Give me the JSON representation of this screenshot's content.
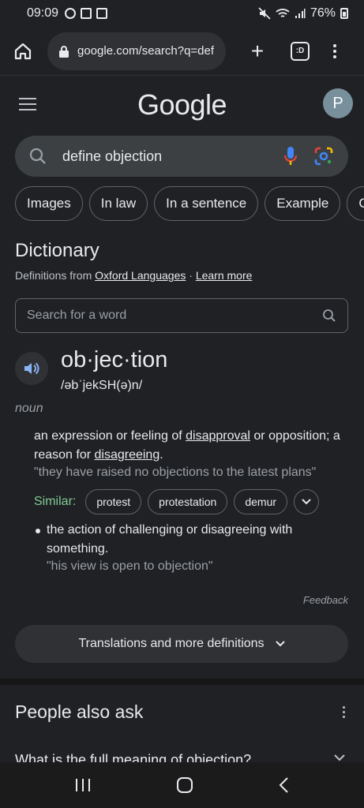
{
  "status_bar": {
    "time": "09:09",
    "battery": "76%"
  },
  "browser": {
    "url": "google.com/search?q=def",
    "tabs_label": ":D"
  },
  "header": {
    "logo": "Google",
    "avatar_letter": "P"
  },
  "search": {
    "query": "define objection"
  },
  "chips": [
    "Images",
    "In law",
    "In a sentence",
    "Example",
    "C"
  ],
  "dictionary": {
    "title": "Dictionary",
    "source_prefix": "Definitions from",
    "source_name": "Oxford Languages",
    "separator": "·",
    "learn_more": "Learn more",
    "word_search_placeholder": "Search for a word",
    "headword": "ob·jec·tion",
    "phonetic": "/əbˈjekSH(ə)n/",
    "part_of_speech": "noun",
    "definitions": [
      {
        "text_a": "an expression or feeling of ",
        "link_a": "disapproval",
        "text_b": " or opposition; a reason for ",
        "link_b": "disagreeing",
        "text_c": ".",
        "example": "\"they have raised no objections to the latest plans\""
      },
      {
        "text": "the action of challenging or disagreeing with something.",
        "example": "\"his view is open to objection\""
      }
    ],
    "similar_label": "Similar:",
    "similar": [
      "protest",
      "protestation",
      "demur"
    ],
    "feedback": "Feedback",
    "more_button": "Translations and more definitions"
  },
  "people_also_ask": {
    "title": "People also ask",
    "first_question": "What is the full meaning of objection?"
  },
  "colors": {
    "background": "#202124",
    "surface": "#303134",
    "similar_label": "#81c995",
    "mic_blue": "#4285f4"
  }
}
